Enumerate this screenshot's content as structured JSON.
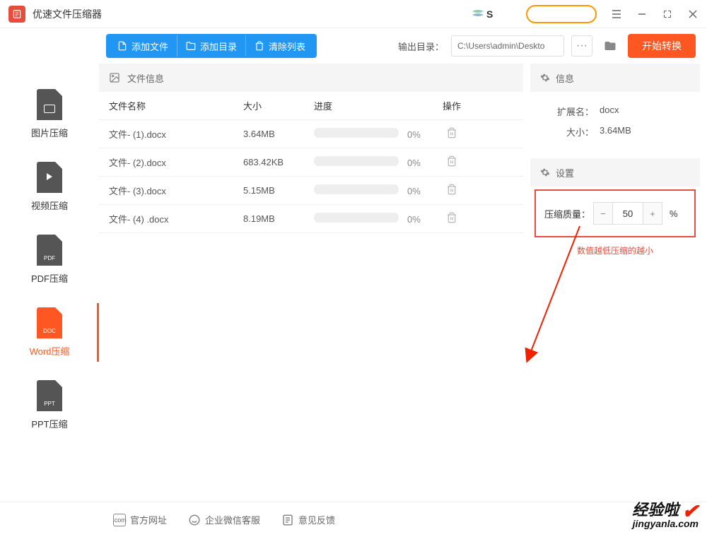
{
  "app": {
    "title": "优速文件压缩器"
  },
  "titlebar": {
    "s_label": "S"
  },
  "toolbar": {
    "add_file": "添加文件",
    "add_dir": "添加目录",
    "clear_list": "清除列表",
    "output_label": "输出目录：",
    "output_path": "C:\\Users\\admin\\Deskto",
    "start": "开始转换"
  },
  "sidebar": {
    "items": [
      {
        "label": "图片压缩",
        "badge": ""
      },
      {
        "label": "视频压缩",
        "badge": ""
      },
      {
        "label": "PDF压缩",
        "badge": "PDF"
      },
      {
        "label": "Word压缩",
        "badge": "DOC"
      },
      {
        "label": "PPT压缩",
        "badge": "PPT"
      }
    ]
  },
  "filelist": {
    "header": "文件信息",
    "cols": {
      "name": "文件名称",
      "size": "大小",
      "progress": "进度",
      "action": "操作"
    },
    "rows": [
      {
        "name": "文件- (1).docx",
        "size": "3.64MB",
        "progress": "0%"
      },
      {
        "name": "文件- (2).docx",
        "size": "683.42KB",
        "progress": "0%"
      },
      {
        "name": "文件- (3).docx",
        "size": "5.15MB",
        "progress": "0%"
      },
      {
        "name": "文件- (4) .docx",
        "size": "8.19MB",
        "progress": "0%"
      }
    ]
  },
  "rpanel": {
    "info_header": "信息",
    "ext_label": "扩展名：",
    "ext_value": "docx",
    "size_label": "大小：",
    "size_value": "3.64MB",
    "settings_header": "设置",
    "quality_label": "压缩质量：",
    "quality_value": "50",
    "percent": "%",
    "note": "数值越低压缩的越小"
  },
  "footer": {
    "website": "官方网址",
    "wechat": "企业微信客服",
    "feedback": "意见反馈"
  },
  "watermark": {
    "top": "经验啦",
    "bottom": "jingyanla.com"
  }
}
